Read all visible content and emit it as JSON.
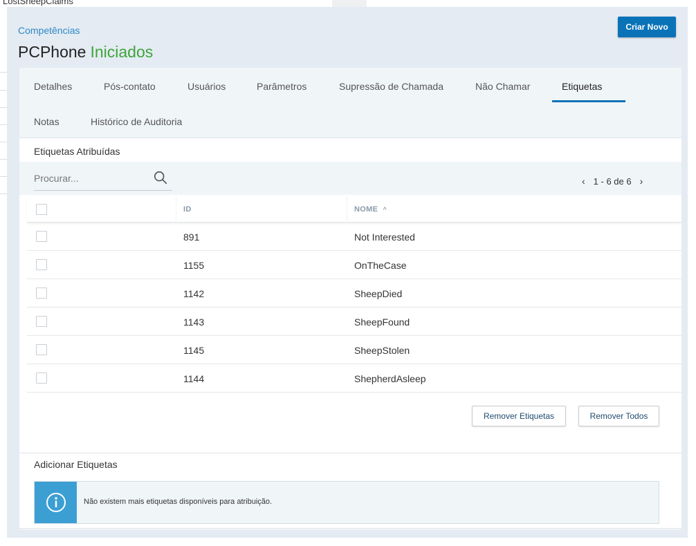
{
  "background": {
    "window_title": "LostSheepClaims"
  },
  "header": {
    "breadcrumb": "Competências",
    "title": "PCPhone",
    "status": "Iniciados",
    "create_button": "Criar Novo"
  },
  "tabs": [
    {
      "label": "Detalhes",
      "active": false
    },
    {
      "label": "Pós-contato",
      "active": false
    },
    {
      "label": "Usuários",
      "active": false
    },
    {
      "label": "Parâmetros",
      "active": false
    },
    {
      "label": "Supressão de Chamada",
      "active": false
    },
    {
      "label": "Não Chamar",
      "active": false
    },
    {
      "label": "Etiquetas",
      "active": true
    },
    {
      "label": "Notas",
      "active": false
    },
    {
      "label": "Histórico de Auditoria",
      "active": false
    }
  ],
  "assigned": {
    "title": "Etiquetas Atribuídas",
    "search_placeholder": "Procurar...",
    "pager": {
      "range": "1 - 6 de 6"
    },
    "columns": {
      "id": "ID",
      "name": "NOME",
      "name_sort": "^"
    },
    "rows": [
      {
        "id": "891",
        "name": "Not Interested"
      },
      {
        "id": "1155",
        "name": "OnTheCase"
      },
      {
        "id": "1142",
        "name": "SheepDied"
      },
      {
        "id": "1143",
        "name": "SheepFound"
      },
      {
        "id": "1145",
        "name": "SheepStolen"
      },
      {
        "id": "1144",
        "name": "ShepherdAsleep"
      }
    ],
    "remove_tags_button": "Remover Etiquetas",
    "remove_all_button": "Remover Todos"
  },
  "add": {
    "title": "Adicionar Etiquetas",
    "info_message": "Não existem mais etiquetas disponíveis para atribuição."
  },
  "colors": {
    "primary": "#0a73b8",
    "link": "#2e88c4",
    "status_green": "#3ea43a",
    "info_blue": "#3c9fd4"
  },
  "icons": [
    "search-icon",
    "chevron-left-icon",
    "chevron-right-icon",
    "info-icon"
  ]
}
